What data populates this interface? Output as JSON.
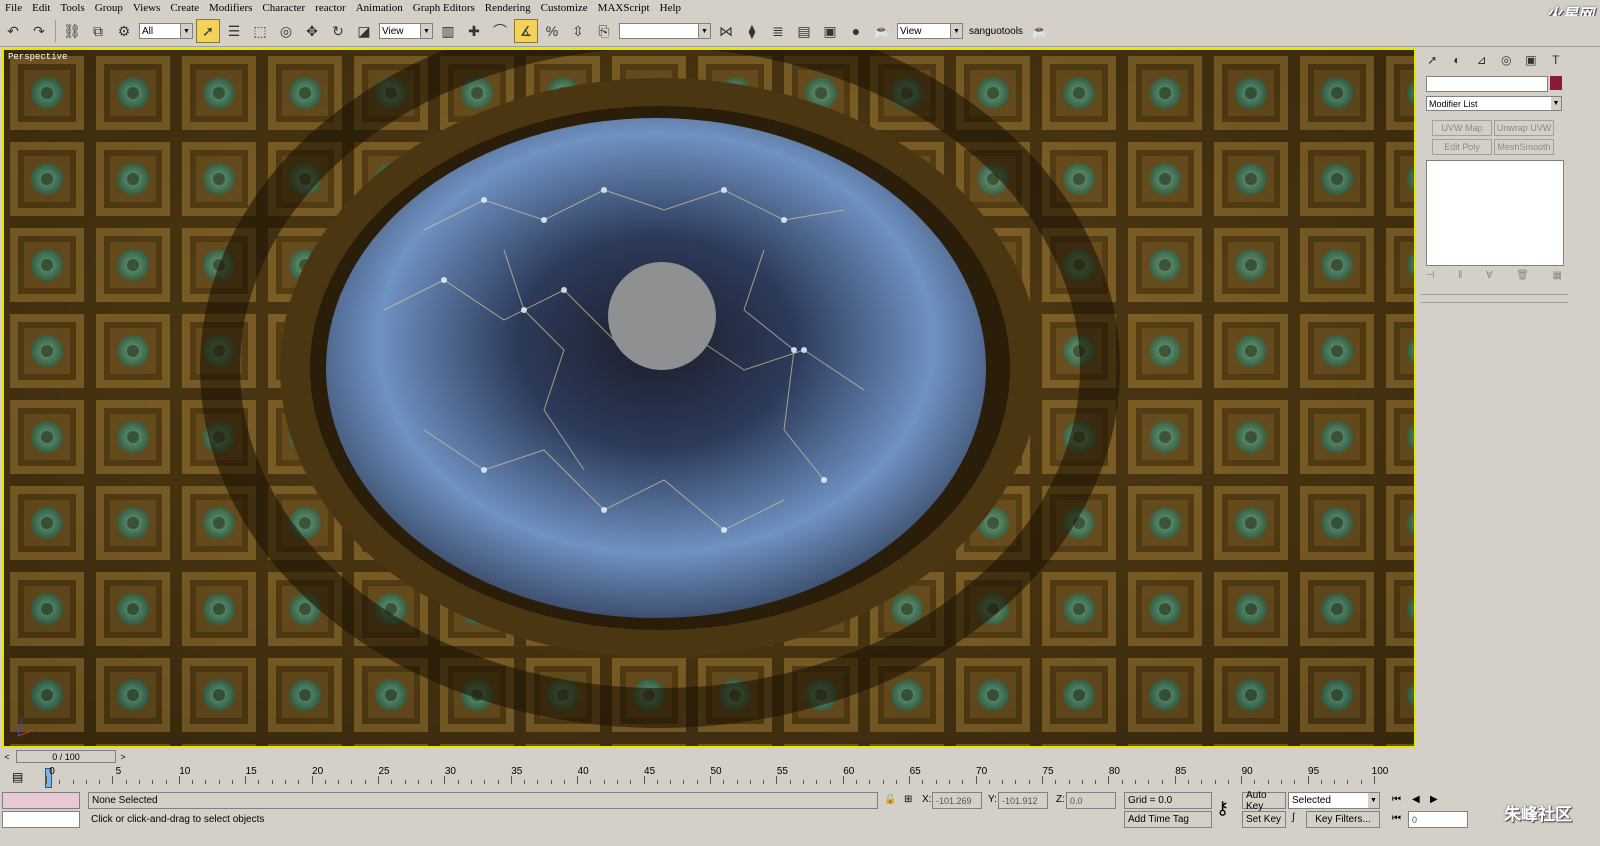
{
  "menu": [
    "File",
    "Edit",
    "Tools",
    "Group",
    "Views",
    "Create",
    "Modifiers",
    "Character",
    "reactor",
    "Animation",
    "Graph Editors",
    "Rendering",
    "Customize",
    "MAXScript",
    "Help"
  ],
  "watermark_top": "火星网",
  "watermark_bottom": "朱峰社区",
  "toolbar": {
    "selection_filter": "All",
    "ref_coord_1": "View",
    "named_sel": "",
    "ref_coord_2": "View",
    "user_label": "sanguotools"
  },
  "viewport": {
    "label": "Perspective"
  },
  "command_panel": {
    "modifier_list": "Modifier List",
    "buttons": [
      "UVW Map",
      "Unwrap UVW",
      "Edit Poly",
      "MeshSmooth"
    ]
  },
  "time_slider": {
    "label": "0 / 100",
    "prev": "<",
    "next": ">"
  },
  "trackbar": {
    "ticks": [
      0,
      5,
      10,
      15,
      20,
      25,
      30,
      35,
      40,
      45,
      50,
      55,
      60,
      65,
      70,
      75,
      80,
      85,
      90,
      95,
      100
    ]
  },
  "status": {
    "selection": "None Selected",
    "prompt": "Click or click-and-drag to select objects",
    "x_label": "X:",
    "x": "-101.269",
    "y_label": "Y:",
    "y": "-101.912",
    "z_label": "Z:",
    "z": "0.0",
    "grid": "Grid = 0.0",
    "add_time_tag": "Add Time Tag",
    "auto_key": "Auto Key",
    "set_key": "Set Key",
    "selected": "Selected",
    "key_filters": "Key Filters...",
    "frame": "0"
  },
  "colors": {
    "ui_grey": "#d4d0c8",
    "viewport_border": "#e6e600",
    "dome_teal": "#3fa88a",
    "ceiling_brown": "#5a4418",
    "sky_blue": "#5f86b8"
  }
}
